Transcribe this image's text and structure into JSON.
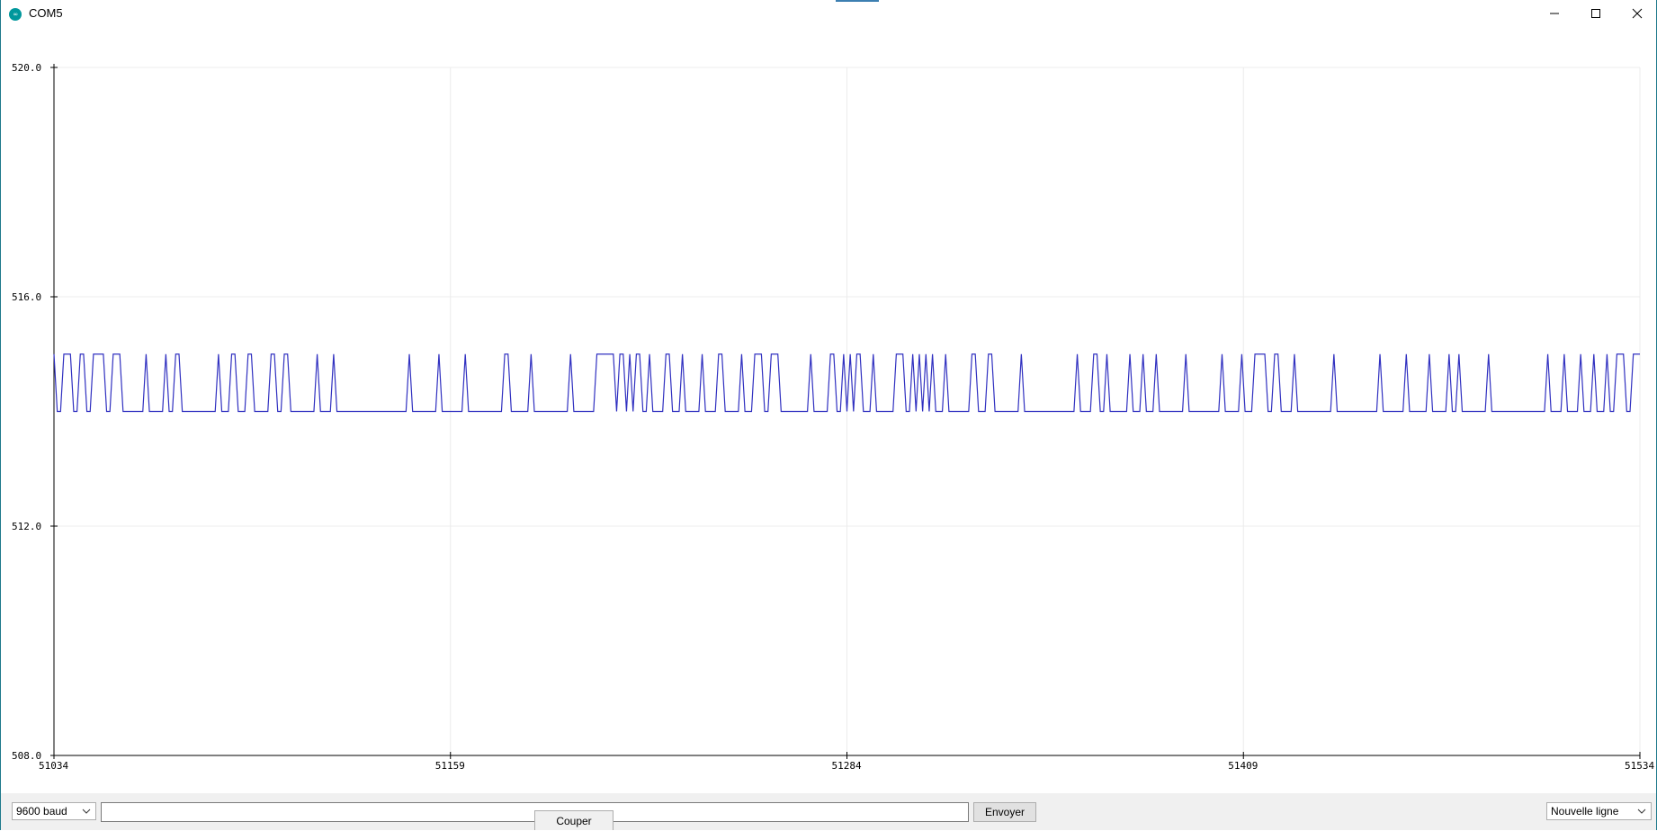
{
  "window": {
    "title": "COM5",
    "icon": "arduino-icon",
    "icon_text": "∞",
    "controls": [
      "minimize-icon",
      "maximize-icon",
      "close-icon"
    ]
  },
  "chart_data": {
    "type": "line",
    "ylim": [
      508.0,
      520.0
    ],
    "y_ticks": [
      "508.0",
      "512.0",
      "516.0",
      "520.0"
    ],
    "y_tick_values": [
      508,
      512,
      516,
      520
    ],
    "xlim": [
      51034,
      51534
    ],
    "x_ticks": [
      "51034",
      "51159",
      "51284",
      "51409",
      "51534"
    ],
    "x_tick_values": [
      51034,
      51159,
      51284,
      51409,
      51534
    ],
    "grid": true,
    "color": "#3030c0",
    "series": [
      {
        "x_start": 51034,
        "values": [
          515,
          514,
          514,
          515,
          515,
          515,
          514,
          514,
          515,
          515,
          514,
          514,
          515,
          515,
          515,
          515,
          514,
          514,
          515,
          515,
          515,
          514,
          514,
          514,
          514,
          514,
          514,
          514,
          515,
          514,
          514,
          514,
          514,
          514,
          515,
          514,
          514,
          515,
          515,
          514,
          514,
          514,
          514,
          514,
          514,
          514,
          514,
          514,
          514,
          514,
          515,
          514,
          514,
          514,
          515,
          515,
          514,
          514,
          514,
          515,
          515,
          514,
          514,
          514,
          514,
          514,
          515,
          515,
          514,
          514,
          515,
          515,
          514,
          514,
          514,
          514,
          514,
          514,
          514,
          514,
          515,
          514,
          514,
          514,
          514,
          515,
          514,
          514,
          514,
          514,
          514,
          514,
          514,
          514,
          514,
          514,
          514,
          514,
          514,
          514,
          514,
          514,
          514,
          514,
          514,
          514,
          514,
          514,
          515,
          514,
          514,
          514,
          514,
          514,
          514,
          514,
          514,
          515,
          514,
          514,
          514,
          514,
          514,
          514,
          514,
          515,
          514,
          514,
          514,
          514,
          514,
          514,
          514,
          514,
          514,
          514,
          514,
          515,
          515,
          514,
          514,
          514,
          514,
          514,
          514,
          515,
          514,
          514,
          514,
          514,
          514,
          514,
          514,
          514,
          514,
          514,
          514,
          515,
          514,
          514,
          514,
          514,
          514,
          514,
          514,
          515,
          515,
          515,
          515,
          515,
          515,
          514,
          515,
          515,
          514,
          515,
          514,
          515,
          515,
          514,
          514,
          515,
          514,
          514,
          514,
          514,
          515,
          515,
          514,
          514,
          514,
          515,
          514,
          514,
          514,
          514,
          514,
          515,
          514,
          514,
          514,
          514,
          515,
          515,
          514,
          514,
          514,
          514,
          514,
          515,
          514,
          514,
          514,
          515,
          515,
          515,
          514,
          514,
          515,
          515,
          515,
          514,
          514,
          514,
          514,
          514,
          514,
          514,
          514,
          514,
          515,
          514,
          514,
          514,
          514,
          514,
          515,
          515,
          514,
          514,
          515,
          514,
          515,
          514,
          515,
          515,
          514,
          514,
          514,
          515,
          514,
          514,
          514,
          514,
          514,
          514,
          515,
          515,
          515,
          514,
          514,
          515,
          514,
          515,
          514,
          515,
          514,
          515,
          514,
          514,
          514,
          515,
          514,
          514,
          514,
          514,
          514,
          514,
          514,
          515,
          515,
          514,
          514,
          514,
          515,
          515,
          514,
          514,
          514,
          514,
          514,
          514,
          514,
          514,
          515,
          514,
          514,
          514,
          514,
          514,
          514,
          514,
          514,
          514,
          514,
          514,
          514,
          514,
          514,
          514,
          514,
          515,
          514,
          514,
          514,
          514,
          515,
          515,
          514,
          514,
          515,
          514,
          514,
          514,
          514,
          514,
          514,
          515,
          514,
          514,
          514,
          515,
          514,
          514,
          514,
          515,
          514,
          514,
          514,
          514,
          514,
          514,
          514,
          514,
          515,
          514,
          514,
          514,
          514,
          514,
          514,
          514,
          514,
          514,
          514,
          515,
          514,
          514,
          514,
          514,
          514,
          515,
          514,
          514,
          514,
          515,
          515,
          515,
          515,
          514,
          514,
          515,
          515,
          514,
          514,
          514,
          514,
          515,
          514,
          514,
          514,
          514,
          514,
          514,
          514,
          514,
          514,
          514,
          514,
          515,
          514,
          514,
          514,
          514,
          514,
          514,
          514,
          514,
          514,
          514,
          514,
          514,
          514,
          515,
          514,
          514,
          514,
          514,
          514,
          514,
          514,
          515,
          514,
          514,
          514,
          514,
          514,
          514,
          515,
          514,
          514,
          514,
          514,
          514,
          515,
          514,
          514,
          515,
          514,
          514,
          514,
          514,
          514,
          514,
          514,
          514,
          515,
          514,
          514,
          514,
          514,
          514,
          514,
          514,
          514,
          514,
          514,
          514,
          514,
          514,
          514,
          514,
          514,
          514,
          515,
          514,
          514,
          514,
          514,
          515,
          514,
          514,
          514,
          514,
          515,
          514,
          514,
          514,
          515,
          514,
          514,
          514,
          515,
          514,
          514,
          515,
          515,
          515,
          514,
          514,
          515,
          515,
          515
        ]
      }
    ]
  },
  "bottom": {
    "baud": "9600 baud",
    "input_value": "",
    "send_label": "Envoyer",
    "cut_label": "Couper",
    "line_ending": "Nouvelle ligne"
  }
}
